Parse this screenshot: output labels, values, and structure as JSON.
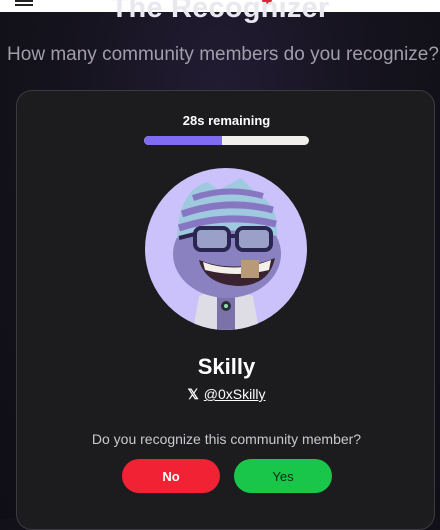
{
  "page": {
    "title": "The Recognizer",
    "subtitle": "How many community members do you recognize?"
  },
  "game": {
    "timer_text": "28s remaining",
    "time_remaining_fraction": 0.47,
    "progress_color": "#7f6cf2",
    "member_name": "Skilly",
    "x_icon_glyph": "𝕏",
    "member_handle": "@0xSkilly",
    "question": "Do you recognize this community member?",
    "no_label": "No",
    "yes_label": "Yes"
  },
  "colors": {
    "no_button": "#f02233",
    "yes_button": "#19c64a",
    "avatar_bg": "#cbc1fb"
  }
}
